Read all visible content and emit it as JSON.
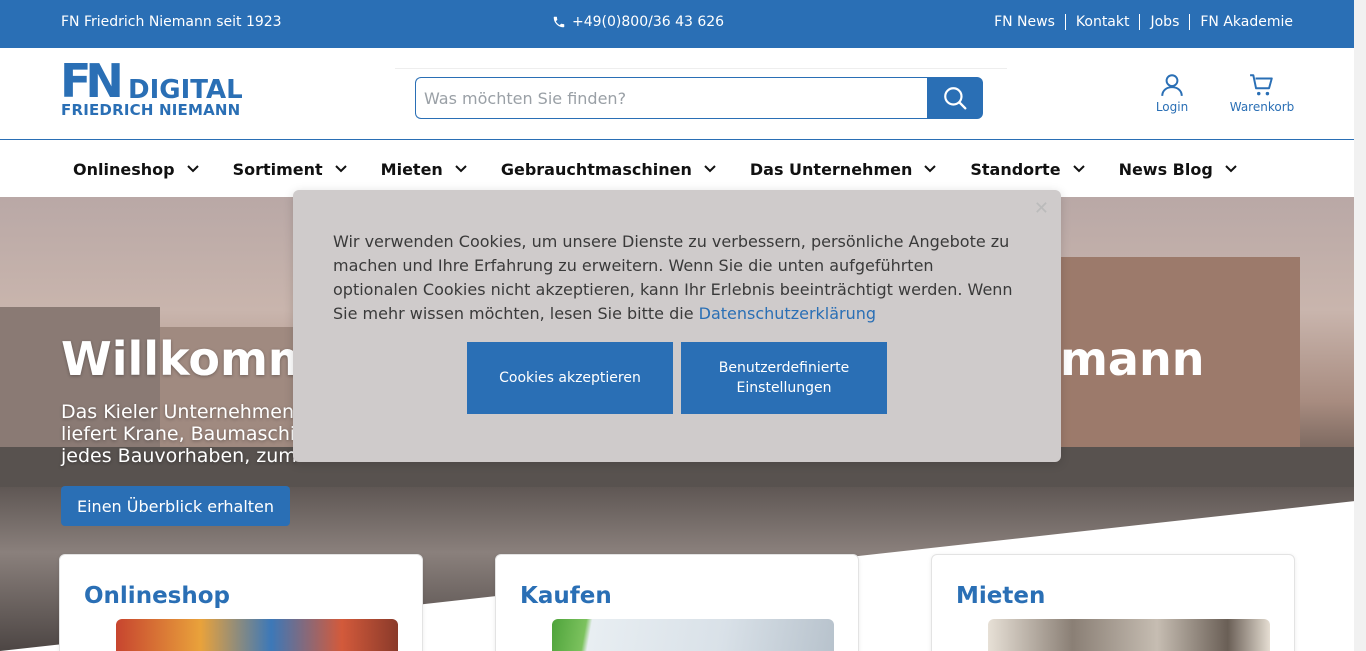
{
  "topbar": {
    "tagline": "FN Friedrich Niemann seit 1923",
    "phone": "+49(0)800/36 43 626",
    "links": [
      "FN News",
      "Kontakt",
      "Jobs",
      "FN Akademie"
    ]
  },
  "header": {
    "logo_fn": "FN",
    "logo_digital": "DIGITAL",
    "logo_name": "FRIEDRICH NIEMANN",
    "search_placeholder": "Was möchten Sie finden?",
    "login_label": "Login",
    "cart_label": "Warenkorb"
  },
  "nav": {
    "items": [
      "Onlineshop",
      "Sortiment",
      "Mieten",
      "Gebrauchtmaschinen",
      "Das Unternehmen",
      "Standorte",
      "News Blog"
    ]
  },
  "hero": {
    "title_left": "Willkomme",
    "title_right": "mann",
    "subtitle_lines": [
      "Das Kieler Unternehmen",
      "liefert Krane, Baumaschi",
      "jedes Bauvorhaben, zum"
    ],
    "cta": "Einen Überblick erhalten"
  },
  "cards": [
    {
      "title": "Onlineshop"
    },
    {
      "title": "Kaufen"
    },
    {
      "title": "Mieten"
    }
  ],
  "cookie": {
    "text": "Wir verwenden Cookies, um unsere Dienste zu verbessern, persönliche Angebote zu machen und Ihre Erfahrung zu erweitern. Wenn Sie die unten aufgeführten optionalen Cookies nicht akzeptieren, kann Ihr Erlebnis beeinträchtigt werden. Wenn Sie mehr wissen möchten, lesen Sie bitte die ",
    "link": "Datenschutzerklärung",
    "accept": "Cookies akzeptieren",
    "custom": "Benutzerdefinierte Einstellungen"
  },
  "colors": {
    "brand": "#2a6fb5",
    "modal_bg": "#cfcbcb"
  }
}
